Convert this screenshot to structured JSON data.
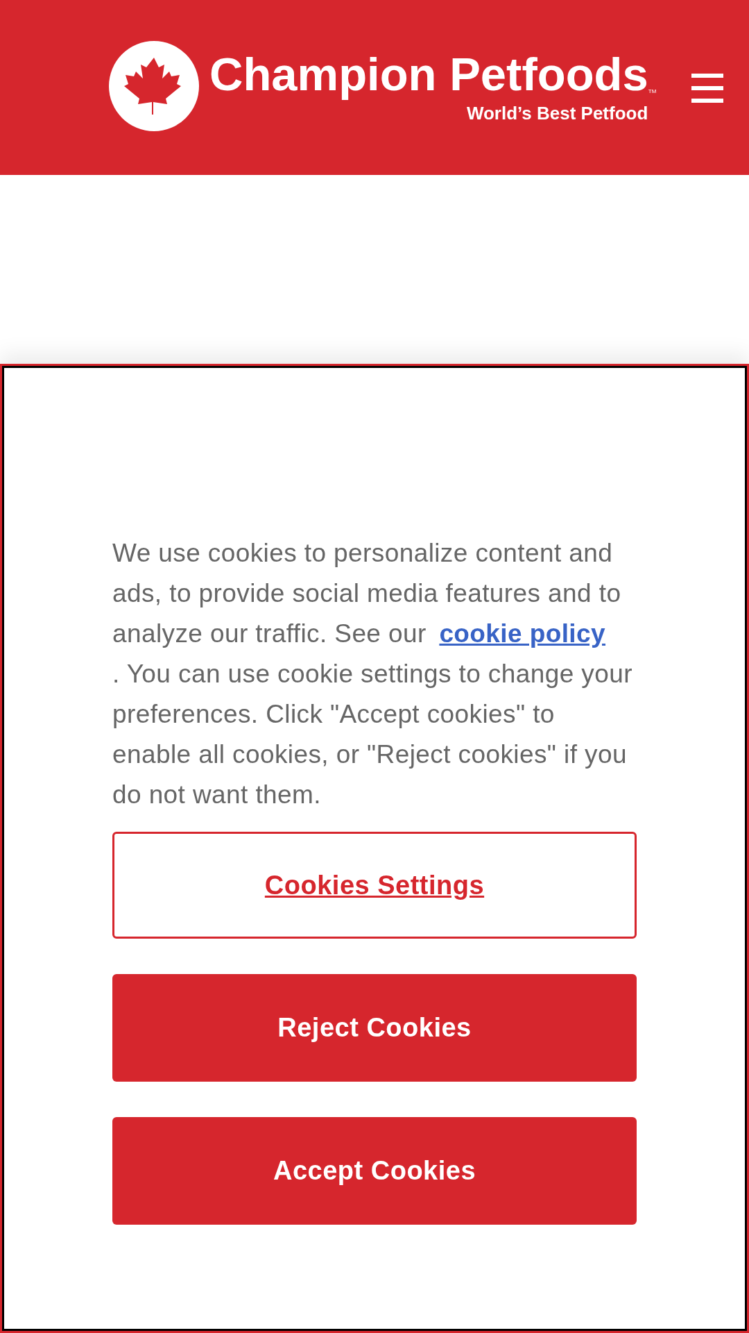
{
  "header": {
    "brand": "Champion Petfoods",
    "trademark": "TM",
    "tagline": "World’s Best Petfood"
  },
  "cookie_banner": {
    "text_before": "We use cookies to personalize content and ads, to provide social media features and to analyze our traffic. See our",
    "link": "cookie policy",
    "text_after": ". You can use cookie settings to change your preferences. Click \"Accept cookies\" to enable all cookies, or \"Reject cookies\" if you do not want them.",
    "buttons": [
      {
        "label": "Cookies Settings",
        "kind": "outline"
      },
      {
        "label": "Reject Cookies",
        "kind": "filled"
      },
      {
        "label": "Accept Cookies",
        "kind": "filled"
      }
    ]
  }
}
